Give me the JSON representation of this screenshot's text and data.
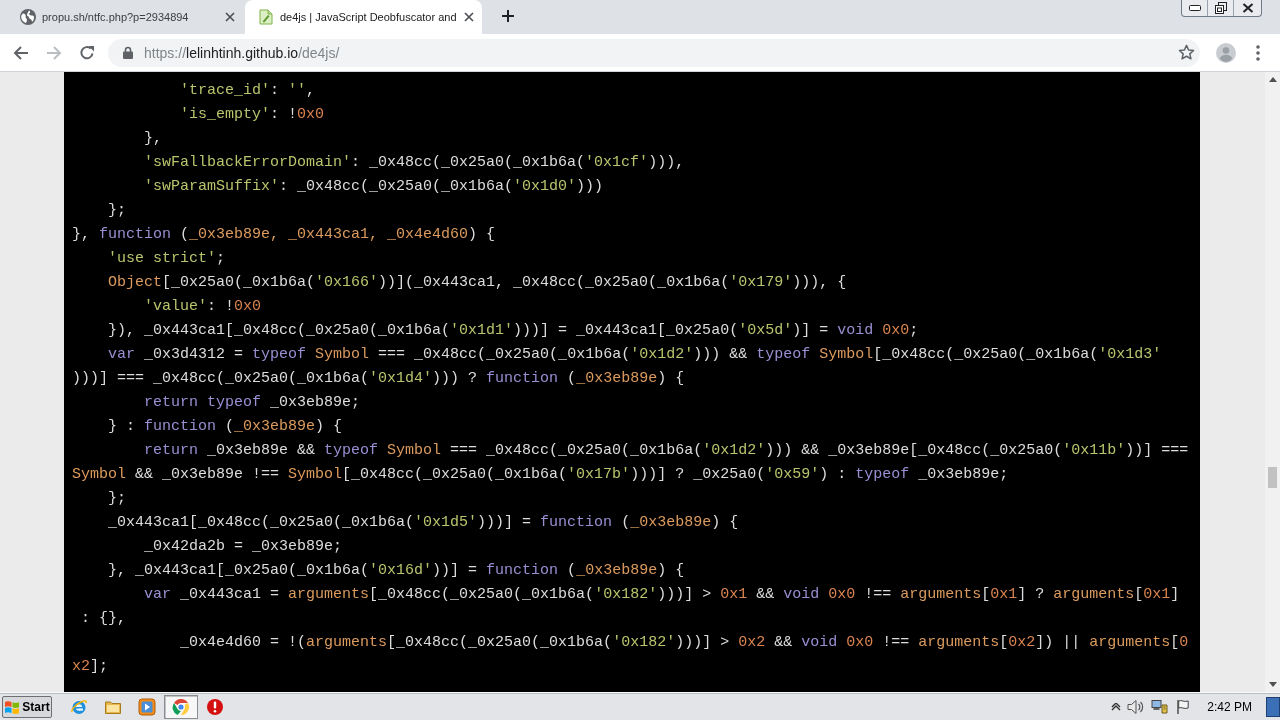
{
  "browser": {
    "tabs": [
      {
        "title": "propu.sh/ntfc.php?p=2934894",
        "selected": false
      },
      {
        "title": "de4js | JavaScript Deobfuscator and",
        "selected": true
      }
    ]
  },
  "toolbar": {
    "nav": [
      {
        "kind": "back",
        "disabled": false
      },
      {
        "kind": "forward",
        "disabled": true
      },
      {
        "kind": "reload",
        "disabled": false
      }
    ],
    "address": {
      "scheme": "https://",
      "host": "lelinhtinh.github.io",
      "path": "/de4js/"
    }
  },
  "code": {
    "lines": [
      {
        "tokens": [
          {
            "kind": "string",
            "text": "            'trace_id'"
          },
          {
            "kind": "plain",
            "text": ": "
          },
          {
            "kind": "string",
            "text": "''"
          },
          {
            "kind": "plain",
            "text": ","
          }
        ]
      },
      {
        "tokens": [
          {
            "kind": "string",
            "text": "            'is_empty'"
          },
          {
            "kind": "plain",
            "text": ": !"
          },
          {
            "kind": "number",
            "text": "0x0"
          }
        ]
      },
      {
        "tokens": [
          {
            "kind": "plain",
            "text": "        },"
          }
        ]
      },
      {
        "tokens": [
          {
            "kind": "string",
            "text": "        'swFallbackErrorDomain'"
          },
          {
            "kind": "plain",
            "text": ": _0x48cc(_0x25a0(_0x1b6a("
          },
          {
            "kind": "string",
            "text": "'0x1cf'"
          },
          {
            "kind": "plain",
            "text": "))),"
          }
        ]
      },
      {
        "tokens": [
          {
            "kind": "string",
            "text": "        'swParamSuffix'"
          },
          {
            "kind": "plain",
            "text": ": _0x48cc(_0x25a0(_0x1b6a("
          },
          {
            "kind": "string",
            "text": "'0x1d0'"
          },
          {
            "kind": "plain",
            "text": ")))"
          }
        ]
      },
      {
        "tokens": [
          {
            "kind": "plain",
            "text": "    };"
          }
        ]
      },
      {
        "tokens": [
          {
            "kind": "plain",
            "text": "}, "
          },
          {
            "kind": "keyword",
            "text": "function"
          },
          {
            "kind": "plain",
            "text": " ("
          },
          {
            "kind": "name",
            "text": "_0x3eb89e, _0x443ca1, _0x4e4d60"
          },
          {
            "kind": "plain",
            "text": ") {"
          }
        ]
      },
      {
        "tokens": [
          {
            "kind": "string",
            "text": "    'use strict'"
          },
          {
            "kind": "plain",
            "text": ";"
          }
        ]
      },
      {
        "tokens": [
          {
            "kind": "name",
            "text": "    Object"
          },
          {
            "kind": "plain",
            "text": "[_0x25a0(_0x1b6a("
          },
          {
            "kind": "string",
            "text": "'0x166'"
          },
          {
            "kind": "plain",
            "text": "))](_0x443ca1, _0x48cc(_0x25a0(_0x1b6a("
          },
          {
            "kind": "string",
            "text": "'0x179'"
          },
          {
            "kind": "plain",
            "text": "))), {"
          }
        ]
      },
      {
        "tokens": [
          {
            "kind": "string",
            "text": "        'value'"
          },
          {
            "kind": "plain",
            "text": ": !"
          },
          {
            "kind": "number",
            "text": "0x0"
          }
        ]
      },
      {
        "tokens": [
          {
            "kind": "plain",
            "text": "    }), _0x443ca1[_0x48cc(_0x25a0(_0x1b6a("
          },
          {
            "kind": "string",
            "text": "'0x1d1'"
          },
          {
            "kind": "plain",
            "text": ")))] = _0x443ca1[_0x25a0("
          },
          {
            "kind": "string",
            "text": "'0x5d'"
          },
          {
            "kind": "plain",
            "text": ")] = "
          },
          {
            "kind": "keyword",
            "text": "void "
          },
          {
            "kind": "number",
            "text": "0x0"
          },
          {
            "kind": "plain",
            "text": ";"
          }
        ]
      },
      {
        "tokens": [
          {
            "kind": "keyword",
            "text": "    var"
          },
          {
            "kind": "plain",
            "text": " _0x3d4312 = "
          },
          {
            "kind": "keyword",
            "text": "typeof "
          },
          {
            "kind": "name",
            "text": "Symbol"
          },
          {
            "kind": "plain",
            "text": " === _0x48cc(_0x25a0(_0x1b6a("
          },
          {
            "kind": "string",
            "text": "'0x1d2'"
          },
          {
            "kind": "plain",
            "text": "))) && "
          },
          {
            "kind": "keyword",
            "text": "typeof "
          },
          {
            "kind": "name",
            "text": "Symbol"
          },
          {
            "kind": "plain",
            "text": "[_0x48cc(_0x25a0(_0x1b6a("
          },
          {
            "kind": "string",
            "text": "'0x1d3'"
          }
        ]
      },
      {
        "tokens": [
          {
            "kind": "plain",
            "text": ")))] === _0x48cc(_0x25a0(_0x1b6a("
          },
          {
            "kind": "string",
            "text": "'0x1d4'"
          },
          {
            "kind": "plain",
            "text": "))) ? "
          },
          {
            "kind": "keyword",
            "text": "function"
          },
          {
            "kind": "plain",
            "text": " ("
          },
          {
            "kind": "name",
            "text": "_0x3eb89e"
          },
          {
            "kind": "plain",
            "text": ") {"
          }
        ]
      },
      {
        "tokens": [
          {
            "kind": "keyword",
            "text": "        return typeof"
          },
          {
            "kind": "plain",
            "text": " _0x3eb89e;"
          }
        ]
      },
      {
        "tokens": [
          {
            "kind": "plain",
            "text": "    } : "
          },
          {
            "kind": "keyword",
            "text": "function"
          },
          {
            "kind": "plain",
            "text": " ("
          },
          {
            "kind": "name",
            "text": "_0x3eb89e"
          },
          {
            "kind": "plain",
            "text": ") {"
          }
        ]
      },
      {
        "tokens": [
          {
            "kind": "keyword",
            "text": "        return"
          },
          {
            "kind": "plain",
            "text": " _0x3eb89e && "
          },
          {
            "kind": "keyword",
            "text": "typeof "
          },
          {
            "kind": "name",
            "text": "Symbol"
          },
          {
            "kind": "plain",
            "text": " === _0x48cc(_0x25a0(_0x1b6a("
          },
          {
            "kind": "string",
            "text": "'0x1d2'"
          },
          {
            "kind": "plain",
            "text": "))) && _0x3eb89e[_0x48cc(_0x25a0("
          },
          {
            "kind": "string",
            "text": "'0x11b'"
          },
          {
            "kind": "plain",
            "text": "))] ==="
          }
        ]
      },
      {
        "tokens": [
          {
            "kind": "name",
            "text": "Symbol"
          },
          {
            "kind": "plain",
            "text": " && _0x3eb89e !== "
          },
          {
            "kind": "name",
            "text": "Symbol"
          },
          {
            "kind": "plain",
            "text": "[_0x48cc(_0x25a0(_0x1b6a("
          },
          {
            "kind": "string",
            "text": "'0x17b'"
          },
          {
            "kind": "plain",
            "text": ")))] ? _0x25a0("
          },
          {
            "kind": "string",
            "text": "'0x59'"
          },
          {
            "kind": "plain",
            "text": ") : "
          },
          {
            "kind": "keyword",
            "text": "typeof"
          },
          {
            "kind": "plain",
            "text": " _0x3eb89e;"
          }
        ]
      },
      {
        "tokens": [
          {
            "kind": "plain",
            "text": "    };"
          }
        ]
      },
      {
        "tokens": [
          {
            "kind": "plain",
            "text": "    _0x443ca1[_0x48cc(_0x25a0(_0x1b6a("
          },
          {
            "kind": "string",
            "text": "'0x1d5'"
          },
          {
            "kind": "plain",
            "text": ")))] = "
          },
          {
            "kind": "keyword",
            "text": "function"
          },
          {
            "kind": "plain",
            "text": " ("
          },
          {
            "kind": "name",
            "text": "_0x3eb89e"
          },
          {
            "kind": "plain",
            "text": ") {"
          }
        ]
      },
      {
        "tokens": [
          {
            "kind": "plain",
            "text": "        _0x42da2b = _0x3eb89e;"
          }
        ]
      },
      {
        "tokens": [
          {
            "kind": "plain",
            "text": "    }, _0x443ca1[_0x25a0(_0x1b6a("
          },
          {
            "kind": "string",
            "text": "'0x16d'"
          },
          {
            "kind": "plain",
            "text": "))] = "
          },
          {
            "kind": "keyword",
            "text": "function"
          },
          {
            "kind": "plain",
            "text": " ("
          },
          {
            "kind": "name",
            "text": "_0x3eb89e"
          },
          {
            "kind": "plain",
            "text": ") {"
          }
        ]
      },
      {
        "tokens": [
          {
            "kind": "keyword",
            "text": "        var"
          },
          {
            "kind": "plain",
            "text": " _0x443ca1 = "
          },
          {
            "kind": "name",
            "text": "arguments"
          },
          {
            "kind": "plain",
            "text": "[_0x48cc(_0x25a0(_0x1b6a("
          },
          {
            "kind": "string",
            "text": "'0x182'"
          },
          {
            "kind": "plain",
            "text": ")))] > "
          },
          {
            "kind": "number",
            "text": "0x1"
          },
          {
            "kind": "plain",
            "text": " && "
          },
          {
            "kind": "keyword",
            "text": "void "
          },
          {
            "kind": "number",
            "text": "0x0"
          },
          {
            "kind": "plain",
            "text": " !== "
          },
          {
            "kind": "name",
            "text": "arguments"
          },
          {
            "kind": "plain",
            "text": "["
          },
          {
            "kind": "number",
            "text": "0x1"
          },
          {
            "kind": "plain",
            "text": "] ? "
          },
          {
            "kind": "name",
            "text": "arguments"
          },
          {
            "kind": "plain",
            "text": "["
          },
          {
            "kind": "number",
            "text": "0x1"
          },
          {
            "kind": "plain",
            "text": "]"
          }
        ]
      },
      {
        "tokens": [
          {
            "kind": "plain",
            "text": " : {},"
          }
        ]
      },
      {
        "tokens": [
          {
            "kind": "plain",
            "text": "            _0x4e4d60 = !("
          },
          {
            "kind": "name",
            "text": "arguments"
          },
          {
            "kind": "plain",
            "text": "[_0x48cc(_0x25a0(_0x1b6a("
          },
          {
            "kind": "string",
            "text": "'0x182'"
          },
          {
            "kind": "plain",
            "text": ")))] > "
          },
          {
            "kind": "number",
            "text": "0x2"
          },
          {
            "kind": "plain",
            "text": " && "
          },
          {
            "kind": "keyword",
            "text": "void "
          },
          {
            "kind": "number",
            "text": "0x0"
          },
          {
            "kind": "plain",
            "text": " !== "
          },
          {
            "kind": "name",
            "text": "arguments"
          },
          {
            "kind": "plain",
            "text": "["
          },
          {
            "kind": "number",
            "text": "0x2"
          },
          {
            "kind": "plain",
            "text": "]) || "
          },
          {
            "kind": "name",
            "text": "arguments"
          },
          {
            "kind": "plain",
            "text": "["
          },
          {
            "kind": "number",
            "text": "0"
          }
        ]
      },
      {
        "tokens": [
          {
            "kind": "number",
            "text": "x2"
          },
          {
            "kind": "plain",
            "text": "];"
          }
        ]
      }
    ]
  },
  "taskbar": {
    "start": "Start",
    "apps": [
      {
        "selected": false
      },
      {
        "selected": false
      },
      {
        "selected": false
      },
      {
        "selected": true
      },
      {
        "selected": false
      }
    ],
    "clock": "2:42 PM"
  }
}
